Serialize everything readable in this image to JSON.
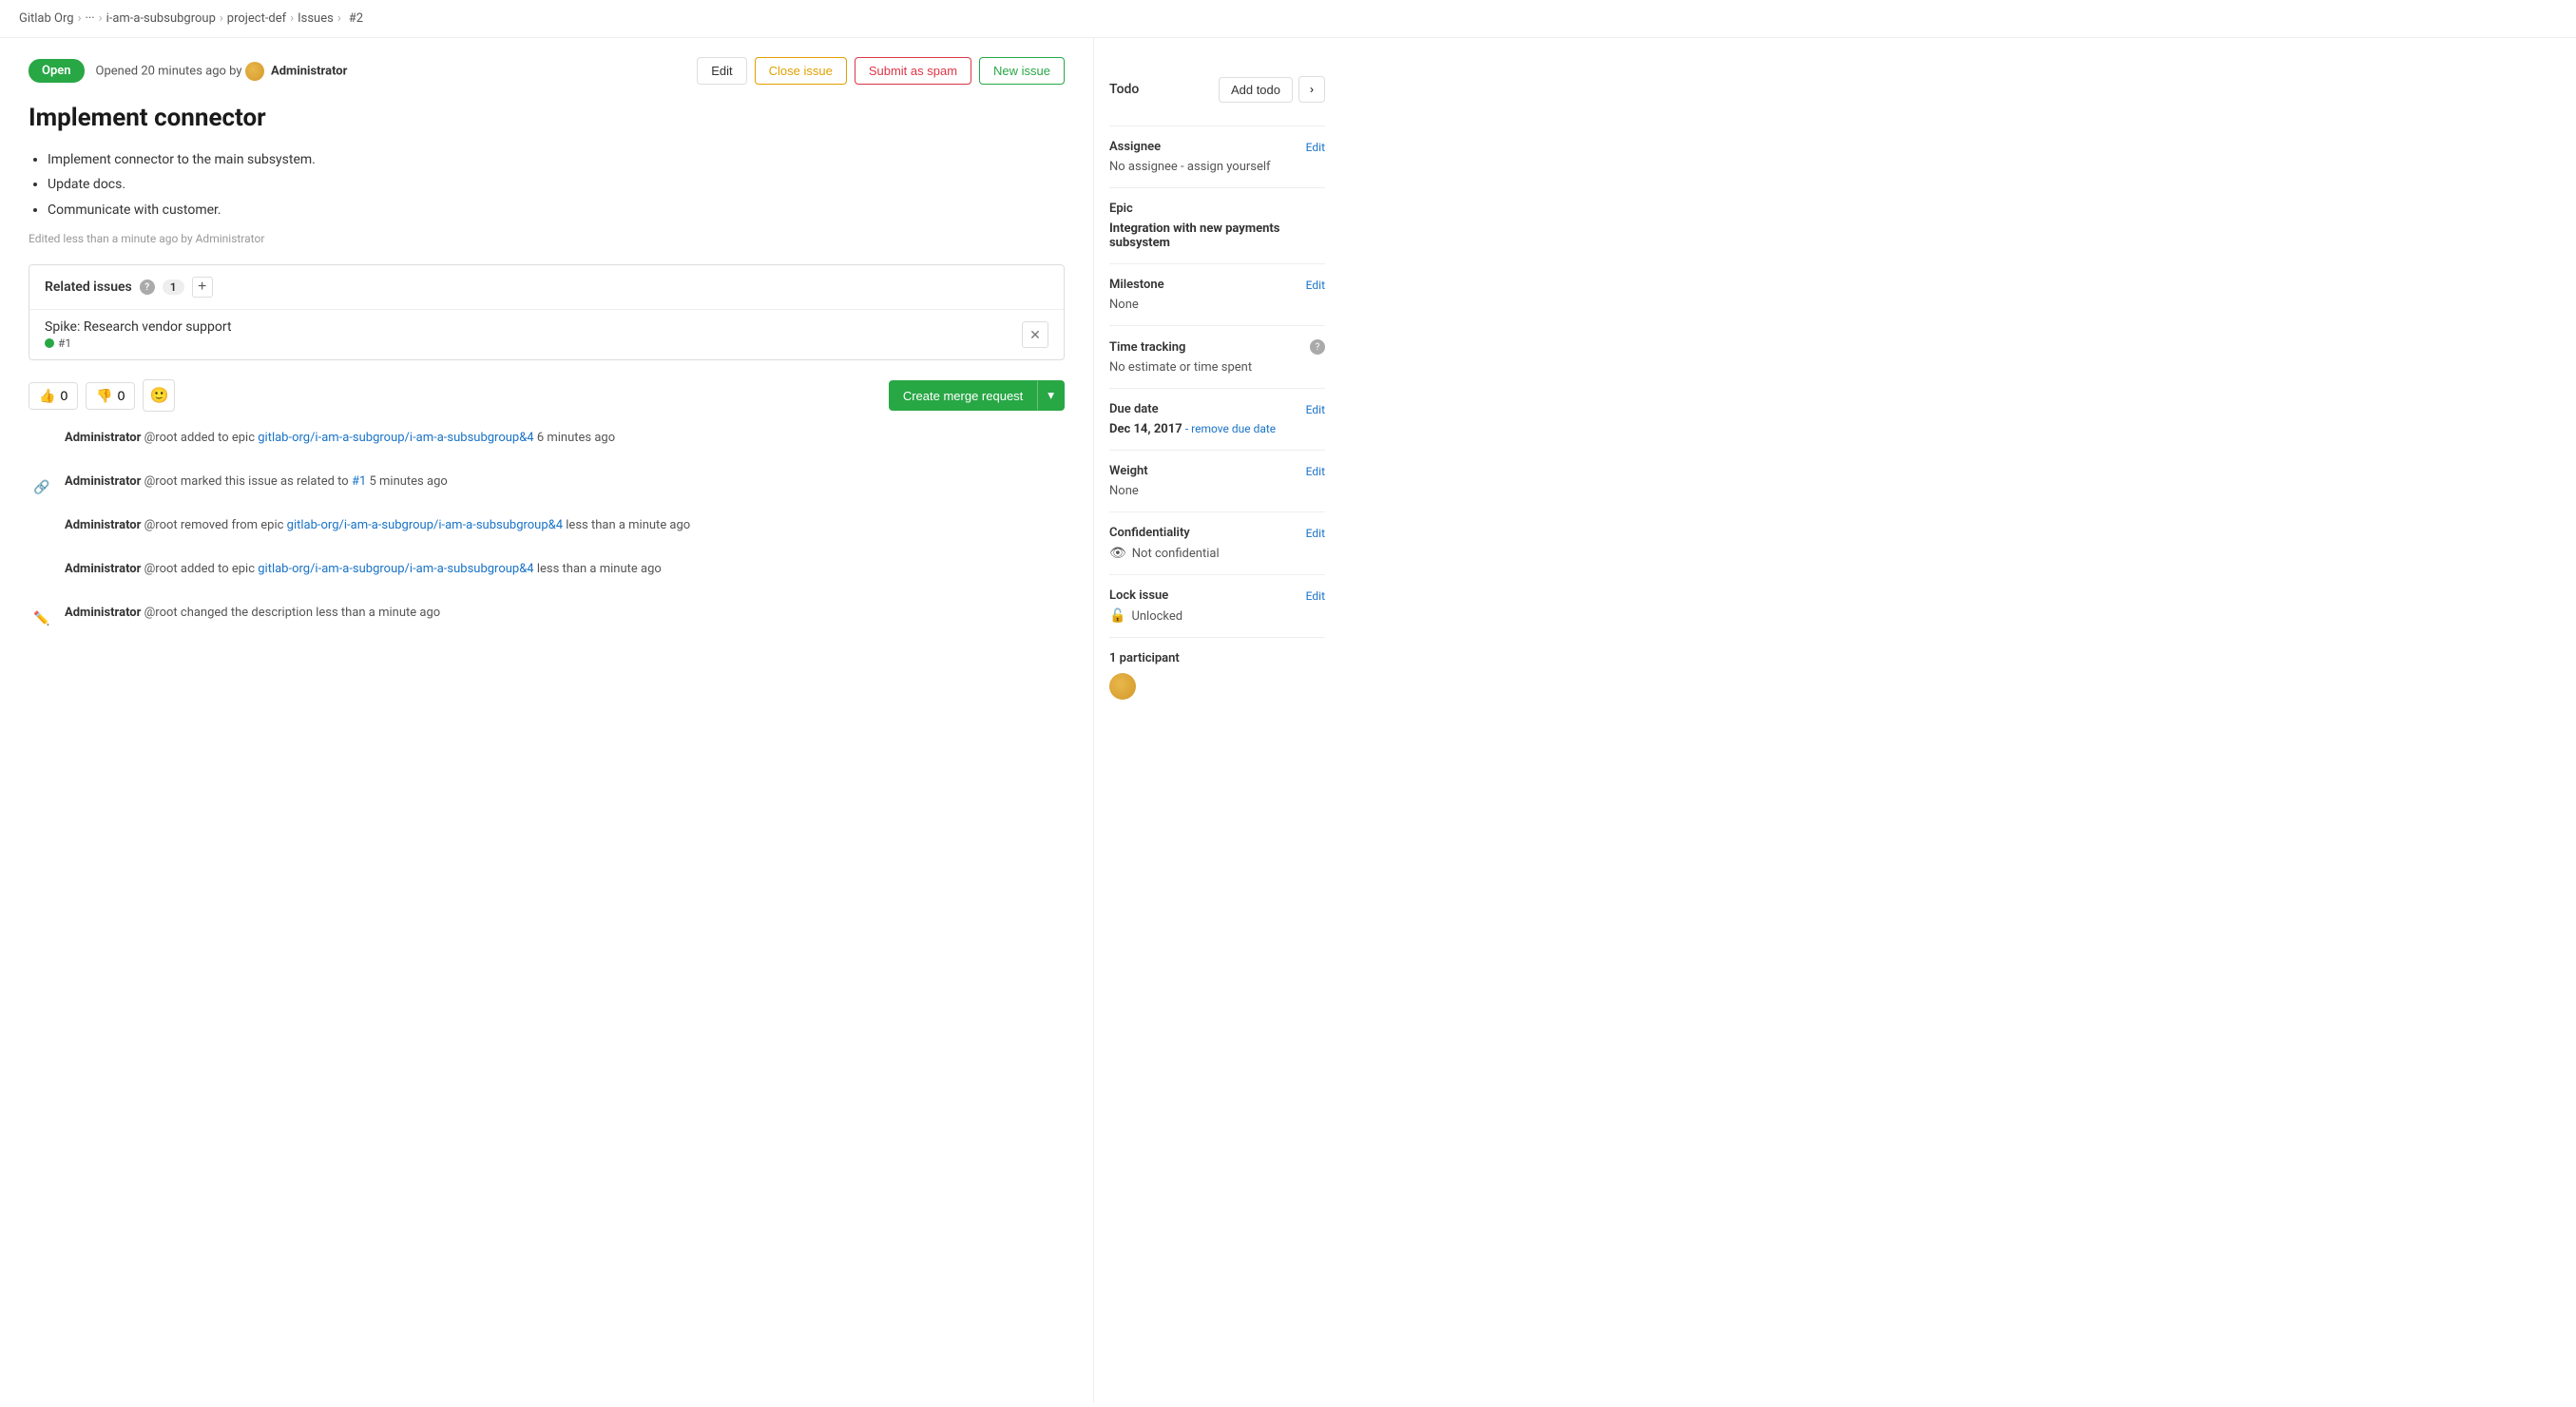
{
  "breadcrumb": {
    "items": [
      {
        "label": "Gitlab Org",
        "sep": true
      },
      {
        "label": "···",
        "sep": true
      },
      {
        "label": "i-am-a-subsubgroup",
        "sep": true
      },
      {
        "label": "project-def",
        "sep": true
      },
      {
        "label": "Issues",
        "sep": true
      },
      {
        "label": "#2",
        "sep": false
      }
    ]
  },
  "issue": {
    "status": "Open",
    "opened_text": "Opened 20 minutes ago by",
    "author": "Administrator",
    "title": "Implement connector",
    "body_items": [
      "Implement connector to the main subsystem.",
      "Update docs.",
      "Communicate with customer."
    ],
    "edited_note": "Edited less than a minute ago by Administrator"
  },
  "actions": {
    "edit_label": "Edit",
    "close_issue_label": "Close issue",
    "submit_spam_label": "Submit as spam",
    "new_issue_label": "New issue"
  },
  "related_issues": {
    "title": "Related issues",
    "count": "1",
    "item_title": "Spike: Research vendor support",
    "item_ref": "#1"
  },
  "reactions": {
    "thumbs_up": "0",
    "thumbs_down": "0",
    "merge_request_btn": "Create merge request"
  },
  "activity": [
    {
      "type": "text",
      "text_prefix": "Administrator @root added to epic ",
      "link_text": "gitlab-org/i-am-a-subgroup/i-am-a-subsubgroup&4",
      "link_href": "#",
      "text_suffix": " 6 minutes ago",
      "icon": "none"
    },
    {
      "type": "link",
      "text_prefix": "Administrator @root marked this issue as related to ",
      "link_text": "#1",
      "link_href": "#",
      "text_suffix": " 5 minutes ago",
      "icon": "link"
    },
    {
      "type": "text",
      "text_prefix": "Administrator @root removed from epic ",
      "link_text": "gitlab-org/i-am-a-subgroup/i-am-a-subsubgroup&4",
      "link_href": "#",
      "text_suffix": " less than a minute ago",
      "icon": "none"
    },
    {
      "type": "text",
      "text_prefix": "Administrator @root added to epic ",
      "link_text": "gitlab-org/i-am-a-subgroup/i-am-a-subsubgroup&4",
      "link_href": "#",
      "text_suffix": " less than a minute ago",
      "icon": "none"
    },
    {
      "type": "pencil",
      "text_prefix": "Administrator @root changed the description less than a minute ago",
      "icon": "pencil"
    }
  ],
  "sidebar": {
    "todo_label": "Todo",
    "add_todo_label": "Add todo",
    "assignee_label": "Assignee",
    "assignee_edit": "Edit",
    "assignee_value": "No assignee - assign yourself",
    "epic_label": "Epic",
    "epic_value": "Integration with new payments subsystem",
    "milestone_label": "Milestone",
    "milestone_edit": "Edit",
    "milestone_value": "None",
    "time_tracking_label": "Time tracking",
    "time_tracking_value": "No estimate or time spent",
    "due_date_label": "Due date",
    "due_date_edit": "Edit",
    "due_date_value": "Dec 14, 2017",
    "remove_due_date": "- remove due date",
    "weight_label": "Weight",
    "weight_edit": "Edit",
    "weight_value": "None",
    "confidentiality_label": "Confidentiality",
    "confidentiality_edit": "Edit",
    "confidentiality_value": "Not confidential",
    "lock_issue_label": "Lock issue",
    "lock_issue_edit": "Edit",
    "lock_issue_value": "Unlocked",
    "participants_label": "1 participant"
  }
}
